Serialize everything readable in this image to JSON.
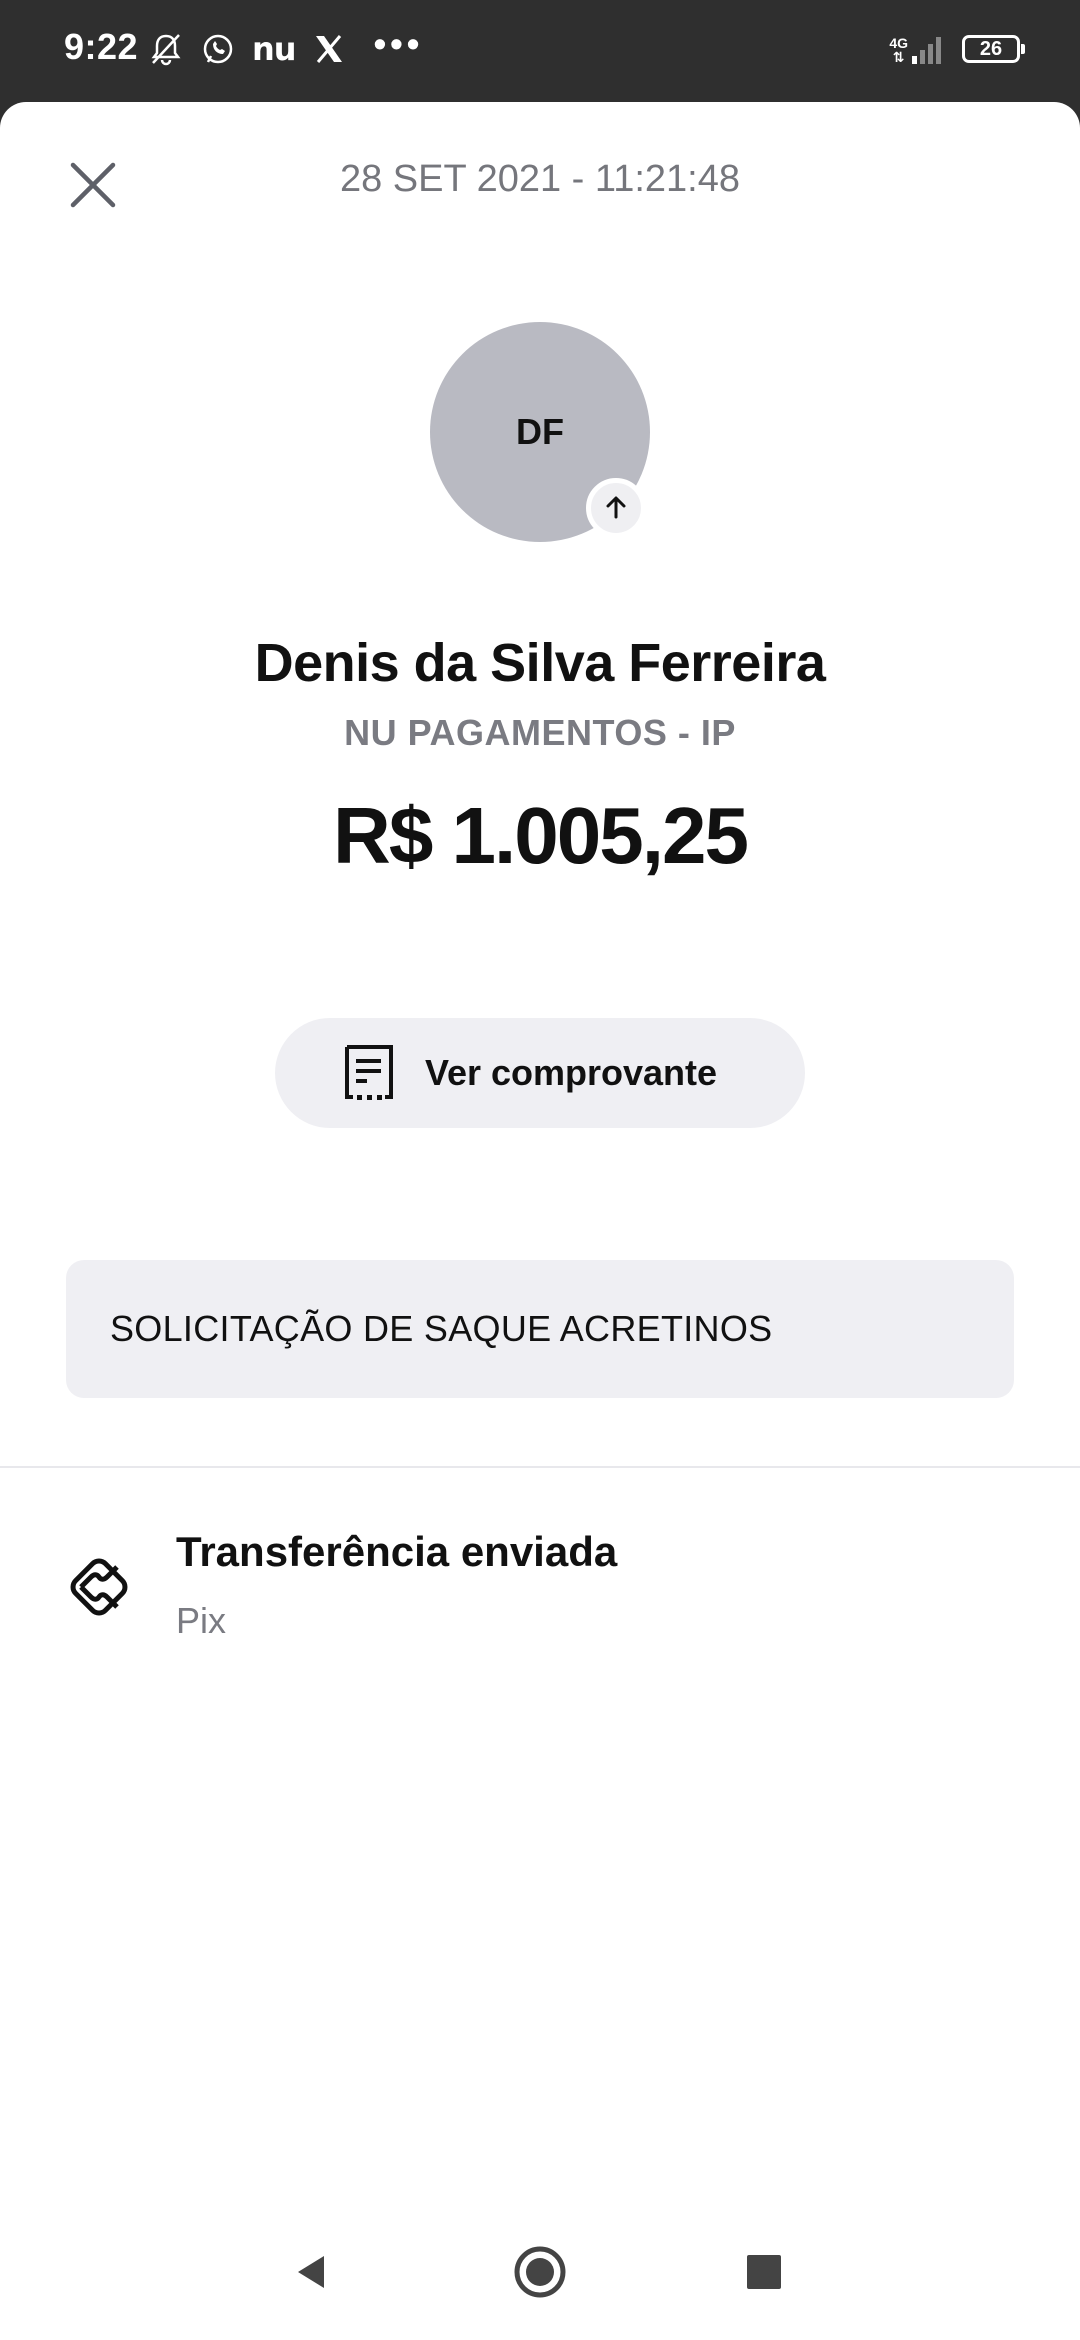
{
  "status_bar": {
    "time": "9:22",
    "left_icons": [
      "alarm-off-icon",
      "whatsapp-icon",
      "nu-icon",
      "x-icon"
    ],
    "nu_label": "nu",
    "more": "•••",
    "network": "4G",
    "battery": "26"
  },
  "header": {
    "close_icon": "close-icon",
    "date": "28 SET 2021 - 11:21:48"
  },
  "contact": {
    "initials": "DF",
    "badge_icon": "arrow-up-icon",
    "name": "Denis da Silva Ferreira",
    "bank": "NU PAGAMENTOS - IP"
  },
  "amount": "R$ 1.005,25",
  "receipt_button": {
    "icon": "receipt-icon",
    "label": "Ver comprovante"
  },
  "message": "SOLICITAÇÃO DE SAQUE ACRETINOS",
  "transaction": {
    "icon": "pix-icon",
    "title": "Transferência enviada",
    "method": "Pix"
  },
  "nav": {
    "back_icon": "back-triangle-icon",
    "home_icon": "home-circle-icon",
    "recents_icon": "recents-square-icon"
  },
  "colors": {
    "status_bar_bg": "#2f2f2f",
    "avatar_bg": "#b9bac2",
    "chip_bg": "#efeff3",
    "muted_text": "#7a7b82"
  }
}
